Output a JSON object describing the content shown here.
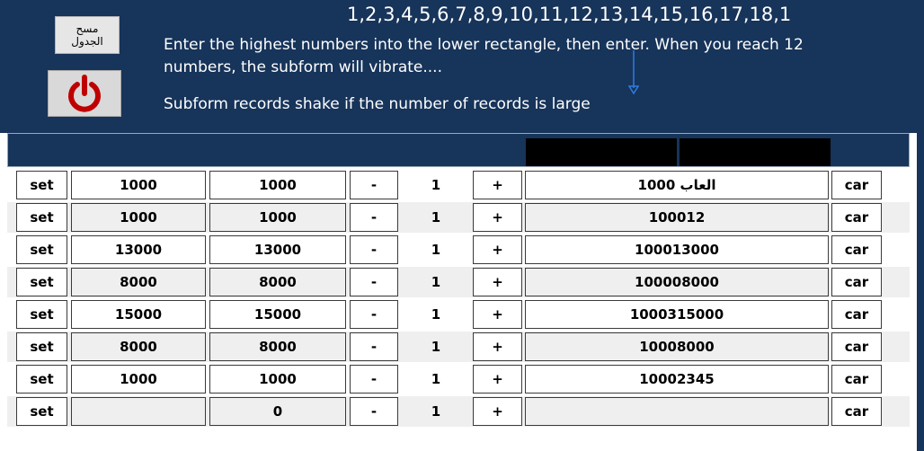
{
  "header": {
    "clear_button_label": "مسح\nالجدول",
    "power_icon": "power-icon",
    "sequence_text": "1,2,3,4,5,6,7,8,9,10,11,12,13,14,15,16,17,18,1",
    "instructions": "Enter the highest numbers into the lower rectangle, then enter. When you reach 12 numbers, the subform will vibrate....",
    "note": "Subform records shake if the number of records is large"
  },
  "colors": {
    "background": "#17345a",
    "power_red": "#c00000",
    "arrow_blue": "#2f7de1"
  },
  "rows": [
    {
      "set": "set",
      "value1": "1000",
      "value2": "1000",
      "minus": "-",
      "qty": "1",
      "plus": "+",
      "name": "العاب 1000",
      "car": "car"
    },
    {
      "set": "set",
      "value1": "1000",
      "value2": "1000",
      "minus": "-",
      "qty": "1",
      "plus": "+",
      "name": "100012",
      "car": "car"
    },
    {
      "set": "set",
      "value1": "13000",
      "value2": "13000",
      "minus": "-",
      "qty": "1",
      "plus": "+",
      "name": "100013000",
      "car": "car"
    },
    {
      "set": "set",
      "value1": "8000",
      "value2": "8000",
      "minus": "-",
      "qty": "1",
      "plus": "+",
      "name": "100008000",
      "car": "car"
    },
    {
      "set": "set",
      "value1": "15000",
      "value2": "15000",
      "minus": "-",
      "qty": "1",
      "plus": "+",
      "name": "1000315000",
      "car": "car"
    },
    {
      "set": "set",
      "value1": "8000",
      "value2": "8000",
      "minus": "-",
      "qty": "1",
      "plus": "+",
      "name": "10008000",
      "car": "car"
    },
    {
      "set": "set",
      "value1": "1000",
      "value2": "1000",
      "minus": "-",
      "qty": "1",
      "plus": "+",
      "name": "10002345",
      "car": "car"
    },
    {
      "set": "set",
      "value1": "",
      "value2": "0",
      "minus": "-",
      "qty": "1",
      "plus": "+",
      "name": "",
      "car": "car"
    }
  ]
}
